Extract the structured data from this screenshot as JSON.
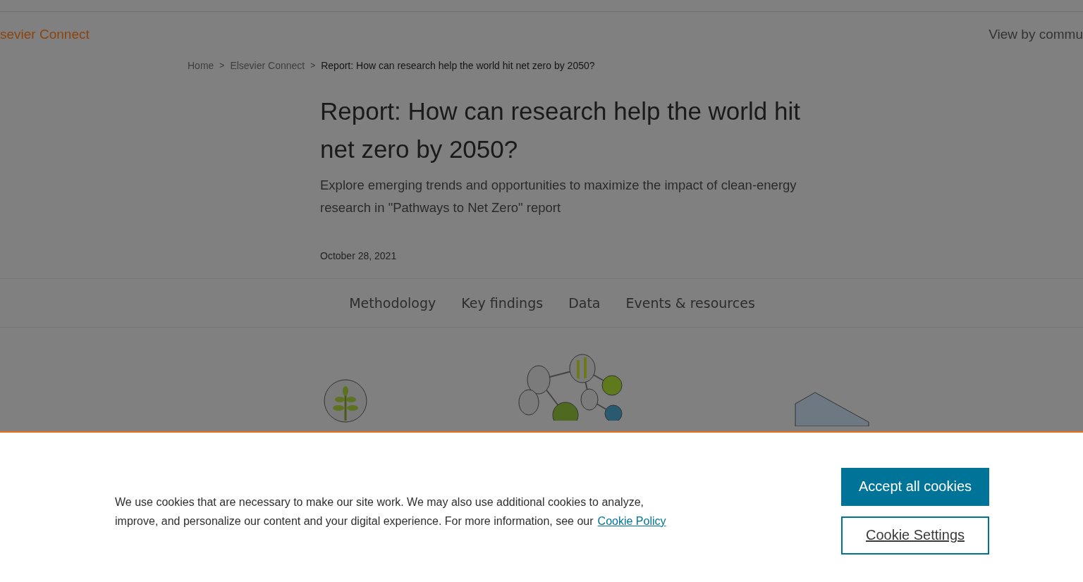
{
  "header": {
    "site_name": "sevier Connect",
    "view_by": "View by commu"
  },
  "breadcrumb": [
    {
      "label": "Home",
      "kind": "link"
    },
    {
      "label": "Elsevier Connect",
      "kind": "link"
    },
    {
      "label": "Report: How can research help the world hit net zero by 2050?",
      "kind": "current"
    }
  ],
  "breadcrumb_separator": ">",
  "article": {
    "title": "Report: How can research help the world hit net zero by 2050?",
    "subtitle": "Explore emerging trends and opportunities to maximize the impact of clean-energy research in \"Pathways to Net Zero\" report",
    "date": "October 28, 2021"
  },
  "section_nav": [
    {
      "label": "Methodology"
    },
    {
      "label": "Key findings"
    },
    {
      "label": "Data"
    },
    {
      "label": "Events & resources"
    }
  ],
  "cookie_banner": {
    "text": "We use cookies that are necessary to make our site work. We may also use additional cookies to analyze, improve, and personalize our content and your digital experience. For more information, see our",
    "link": "Cookie Policy",
    "buttons": [
      {
        "label": "Accept all cookies",
        "kind": "primary"
      },
      {
        "label": "Cookie Settings",
        "kind": "secondary"
      }
    ]
  }
}
